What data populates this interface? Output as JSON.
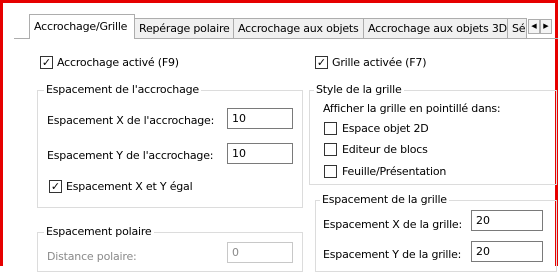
{
  "tabs": [
    {
      "label": "Accrochage/Grille",
      "active": true
    },
    {
      "label": "Repérage polaire",
      "active": false
    },
    {
      "label": "Accrochage aux objets",
      "active": false
    },
    {
      "label": "Accrochage aux objets 3D",
      "active": false
    },
    {
      "label": "Sélection",
      "active": false
    }
  ],
  "tab_scroll": {
    "left": "◀",
    "right": "▶"
  },
  "snap": {
    "enabled_label": "Accrochage activé (F9)",
    "enabled_checked": true,
    "spacing_group_title": "Espacement de l'accrochage",
    "x_label": "Espacement X de l'accrochage:",
    "x_value": "10",
    "y_label": "Espacement Y de l'accrochage:",
    "y_value": "10",
    "equal_label": "Espacement X et Y égal",
    "equal_checked": true
  },
  "polar": {
    "group_title": "Espacement polaire",
    "distance_label": "Distance polaire:",
    "distance_value": "0"
  },
  "grid": {
    "enabled_label": "Grille activée (F7)",
    "enabled_checked": true,
    "style_group_title": "Style de la grille",
    "style_caption": "Afficher la grille en pointillé dans:",
    "style_options": [
      {
        "label": "Espace objet 2D",
        "checked": false
      },
      {
        "label": "Editeur de blocs",
        "checked": false
      },
      {
        "label": "Feuille/Présentation",
        "checked": false
      }
    ],
    "spacing_group_title": "Espacement de la grille",
    "x_label": "Espacement X de la grille:",
    "x_value": "20",
    "y_label": "Espacement Y de la grille:",
    "y_value": "20"
  },
  "colors": {
    "highlight_border": "#e60000"
  }
}
